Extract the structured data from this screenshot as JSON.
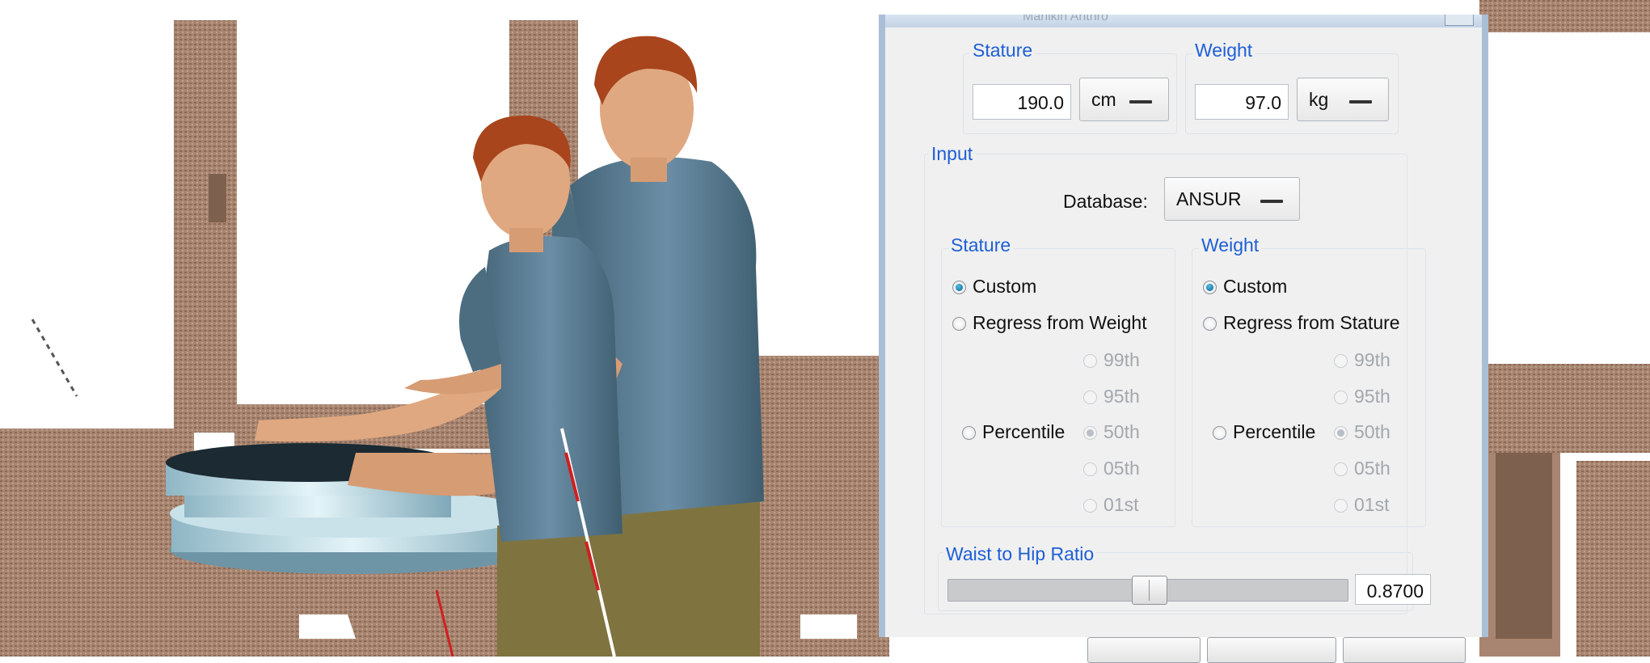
{
  "dialog": {
    "title": "Manikin Anthro",
    "stature_top": {
      "legend": "Stature",
      "value": "190.0",
      "unit": "cm"
    },
    "weight_top": {
      "legend": "Weight",
      "value": "97.0",
      "unit": "kg"
    },
    "input": {
      "legend": "Input",
      "database_label": "Database:",
      "database_value": "ANSUR",
      "stature": {
        "legend": "Stature",
        "custom": "Custom",
        "regress": "Regress from Weight",
        "percentile": "Percentile",
        "options": [
          "99th",
          "95th",
          "50th",
          "05th",
          "01st"
        ],
        "selected": "custom"
      },
      "weight": {
        "legend": "Weight",
        "custom": "Custom",
        "regress": "Regress from Stature",
        "percentile": "Percentile",
        "options": [
          "99th",
          "95th",
          "50th",
          "05th",
          "01st"
        ],
        "selected": "custom"
      }
    },
    "waist_hip": {
      "legend": "Waist to Hip Ratio",
      "value": "0.8700",
      "slider_fraction": 0.52
    }
  },
  "icons": [
    "radio-icon",
    "dropdown-icon"
  ],
  "colors": {
    "accent": "#1e5fd6",
    "shirt": "#587a91",
    "pants": "#7f7440",
    "skin": "#e0a880",
    "hair": "#a8451c"
  }
}
